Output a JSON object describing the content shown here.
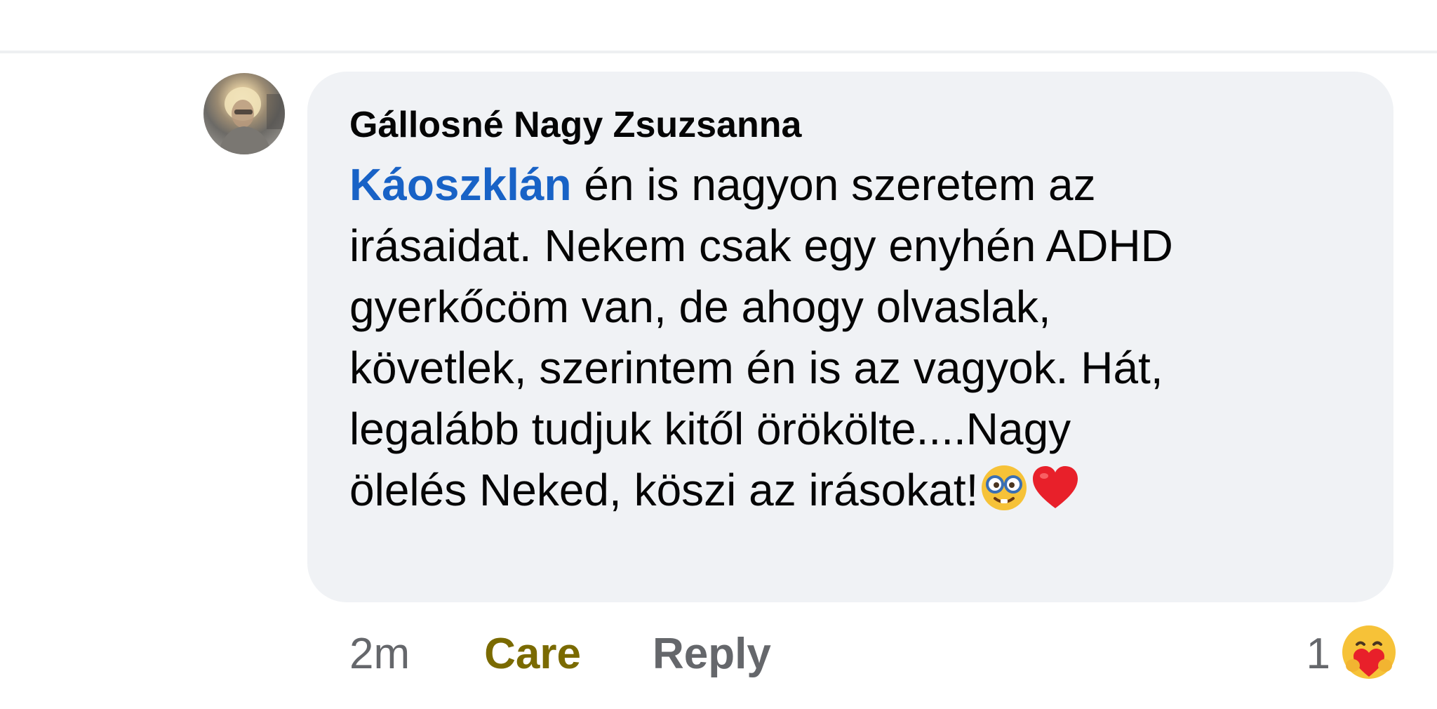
{
  "comment": {
    "author": "Gállosné Nagy Zsuzsanna",
    "mention": "Káoszklán",
    "lines": [
      " én is nagyon szeretem az",
      "irásaidat. Nekem csak egy enyhén ADHD",
      "gyerkőcöm van, de ahogy olvaslak,",
      "követlek, szerintem én is az vagyok. Hát,",
      "legalább tudjuk kitől örökölte....Nagy",
      "ölelés Neked, köszi az irásokat!"
    ],
    "trailing_emojis": [
      "nerd-face-emoji",
      "red-heart-emoji"
    ]
  },
  "actions": {
    "time": "2m",
    "care_label": "Care",
    "reply_label": "Reply"
  },
  "reaction": {
    "count": "1",
    "icon": "care-reaction-icon"
  },
  "colors": {
    "bubble": "#f0f2f5",
    "mention": "#1862c6",
    "care": "#7a6a00",
    "muted": "#65676b"
  }
}
